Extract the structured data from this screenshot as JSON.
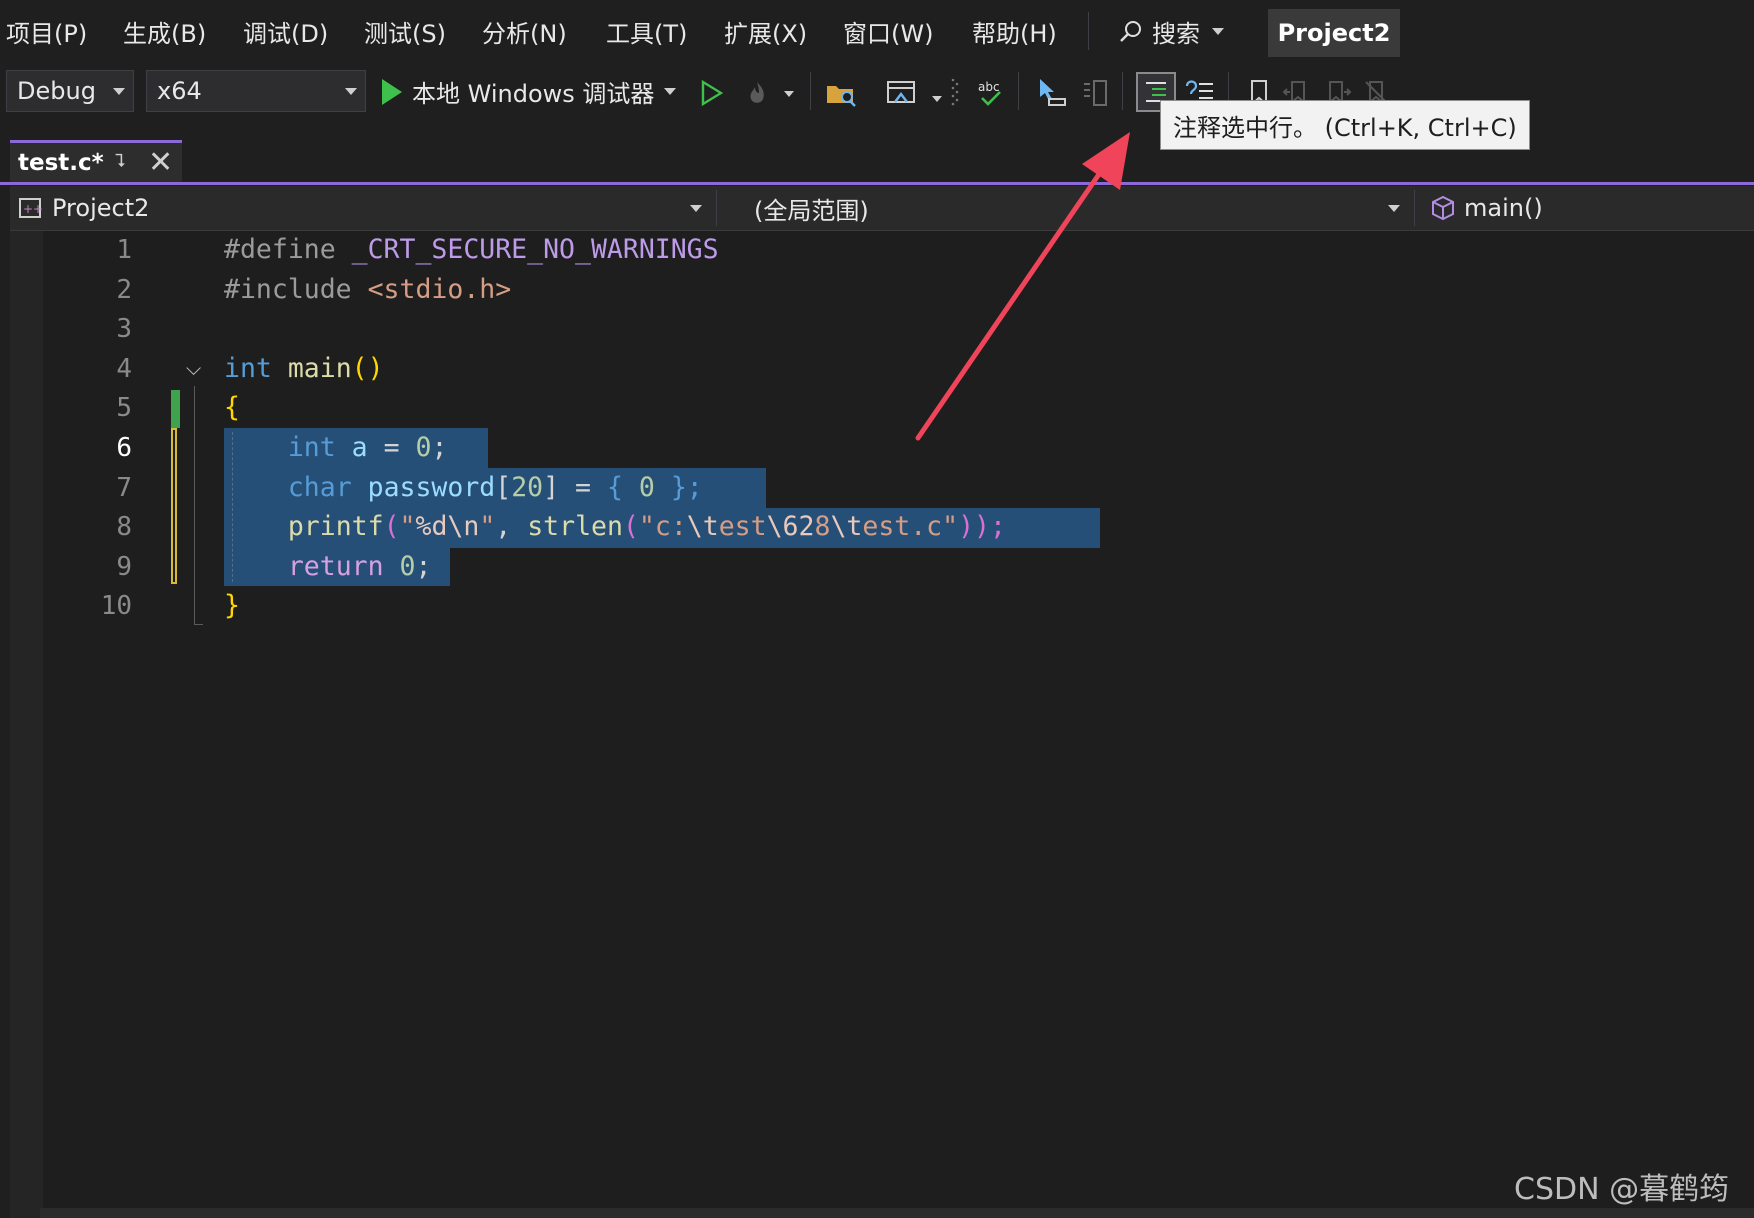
{
  "menu": {
    "items": [
      "项目(P)",
      "生成(B)",
      "调试(D)",
      "测试(S)",
      "分析(N)",
      "工具(T)",
      "扩展(X)",
      "窗口(W)",
      "帮助(H)"
    ],
    "search_label": "搜索",
    "project_name": "Project2"
  },
  "toolbar": {
    "configuration": "Debug",
    "platform": "x64",
    "run_label": "本地 Windows 调试器",
    "tooltip": "注释选中行。 (Ctrl+K, Ctrl+C)"
  },
  "tab": {
    "title": "test.c*"
  },
  "navbar": {
    "project": "Project2",
    "scope": "(全局范围)",
    "member": "main()"
  },
  "editor": {
    "line_numbers": [
      "1",
      "2",
      "3",
      "4",
      "5",
      "6",
      "7",
      "8",
      "9",
      "10"
    ],
    "current_line": "6",
    "code": [
      [
        {
          "t": "#define ",
          "c": "pre"
        },
        {
          "t": "_CRT_SECURE_NO_WARNINGS",
          "c": "macro"
        }
      ],
      [
        {
          "t": "#include ",
          "c": "pre"
        },
        {
          "t": "<stdio.h>",
          "c": "str"
        }
      ],
      [],
      [
        {
          "t": "int ",
          "c": "kw"
        },
        {
          "t": "main",
          "c": "fn"
        },
        {
          "t": "()",
          "c": "brace"
        }
      ],
      [
        {
          "t": "{",
          "c": "brace"
        }
      ],
      [
        {
          "t": "    ",
          "c": "punc"
        },
        {
          "t": "int ",
          "c": "kw"
        },
        {
          "t": "a",
          "c": "var"
        },
        {
          "t": " = ",
          "c": "punc"
        },
        {
          "t": "0",
          "c": "num"
        },
        {
          "t": ";",
          "c": "punc"
        }
      ],
      [
        {
          "t": "    ",
          "c": "punc"
        },
        {
          "t": "char ",
          "c": "kw"
        },
        {
          "t": "password",
          "c": "var"
        },
        {
          "t": "[",
          "c": "punc"
        },
        {
          "t": "20",
          "c": "num"
        },
        {
          "t": "] = ",
          "c": "punc"
        },
        {
          "t": "{ ",
          "c": "kw"
        },
        {
          "t": "0",
          "c": "num"
        },
        {
          "t": " };",
          "c": "kw"
        }
      ],
      [
        {
          "t": "    ",
          "c": "punc"
        },
        {
          "t": "printf",
          "c": "fn"
        },
        {
          "t": "(",
          "c": "paren"
        },
        {
          "t": "\"",
          "c": "str"
        },
        {
          "t": "%d\\n",
          "c": "esc"
        },
        {
          "t": "\"",
          "c": "str"
        },
        {
          "t": ", ",
          "c": "punc"
        },
        {
          "t": "strlen",
          "c": "fn"
        },
        {
          "t": "(",
          "c": "paren"
        },
        {
          "t": "\"c:",
          "c": "str"
        },
        {
          "t": "\\t",
          "c": "esc"
        },
        {
          "t": "est",
          "c": "str"
        },
        {
          "t": "\\62",
          "c": "esc"
        },
        {
          "t": "8",
          "c": "str"
        },
        {
          "t": "\\t",
          "c": "esc"
        },
        {
          "t": "est.c\"",
          "c": "str"
        },
        {
          "t": "));",
          "c": "paren"
        }
      ],
      [
        {
          "t": "    ",
          "c": "punc"
        },
        {
          "t": "return ",
          "c": "ret"
        },
        {
          "t": "0",
          "c": "num"
        },
        {
          "t": ";",
          "c": "punc"
        }
      ],
      [
        {
          "t": "}",
          "c": "brace"
        }
      ]
    ]
  },
  "watermark": "CSDN @暮鹤筠",
  "colors": {
    "accent": "#8b6ad8",
    "selection": "#264f78",
    "keyword": "#569cd6",
    "function": "#dcdcaa",
    "variable": "#9cdcfe",
    "string": "#d69d85",
    "number": "#b5cea8",
    "arrow": "#f0445a"
  }
}
